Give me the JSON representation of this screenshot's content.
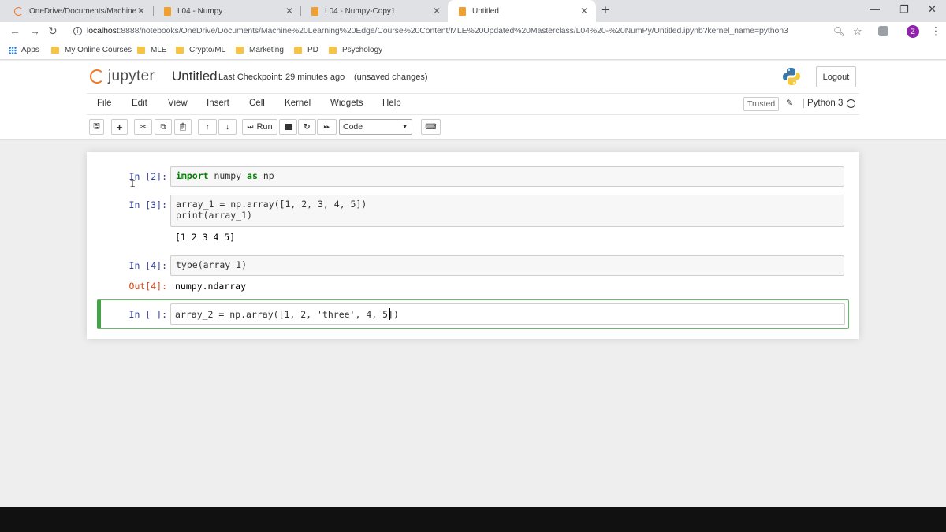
{
  "browser": {
    "tabs": [
      {
        "title": "OneDrive/Documents/Machine L"
      },
      {
        "title": "L04 - Numpy"
      },
      {
        "title": "L04 - Numpy-Copy1"
      },
      {
        "title": "Untitled"
      }
    ],
    "new_tab": "+",
    "url_host": "localhost",
    "url_path": ":8888/notebooks/OneDrive/Documents/Machine%20Learning%20Edge/Course%20Content/MLE%20Updated%20Masterclass/L04%20-%20NumPy/Untitled.ipynb?kernel_name=python3",
    "profile_initial": "Z",
    "bookmarks": [
      "Apps",
      "My Online Courses",
      "MLE",
      "Crypto/ML",
      "Marketing",
      "PD",
      "Psychology"
    ]
  },
  "jupyter": {
    "logo_text": "jupyter",
    "notebook_title": "Untitled",
    "checkpoint": "Last Checkpoint: 29 minutes ago",
    "unsaved": "(unsaved changes)",
    "logout": "Logout",
    "menu": [
      "File",
      "Edit",
      "View",
      "Insert",
      "Cell",
      "Kernel",
      "Widgets",
      "Help"
    ],
    "trusted": "Trusted",
    "kernel_name": "Python 3",
    "toolbar": {
      "run_label": "Run",
      "cell_type": "Code"
    }
  },
  "cells": [
    {
      "in_prompt": "In [2]:",
      "code": "import numpy as np"
    },
    {
      "in_prompt": "In [3]:",
      "code_line1": "array_1 = np.array([1, 2, 3, 4, 5])",
      "code_line2": "print(array_1)",
      "stdout": "[1 2 3 4 5]"
    },
    {
      "in_prompt": "In [4]:",
      "code": "type(array_1)",
      "out_prompt": "Out[4]:",
      "out": "numpy.ndarray"
    },
    {
      "in_prompt": "In [ ]:",
      "code": "array_2 = np.array([1, 2, 'three', 4, 5])"
    }
  ],
  "colors": {
    "jupyter_orange": "#f37726",
    "selected_cell": "#42a545",
    "in_prompt": "#303f9f",
    "out_prompt": "#d84315"
  }
}
